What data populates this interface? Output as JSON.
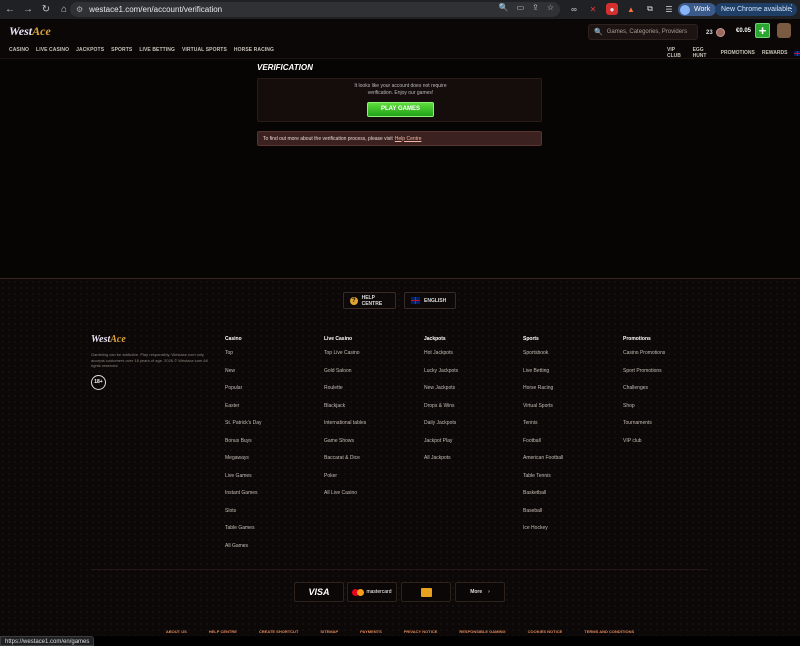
{
  "browser": {
    "url": "westace1.com/en/account/verification",
    "profile_label": "Work",
    "update_label": "New Chrome available",
    "status_url": "https://westace1.com/en/games"
  },
  "header": {
    "logo": {
      "a": "West",
      "b": "Ace"
    },
    "nav": [
      "CASINO",
      "LIVE CASINO",
      "JACKPOTS",
      "SPORTS",
      "LIVE BETTING",
      "VIRTUAL SPORTS",
      "HORSE RACING"
    ],
    "search_placeholder": "Games, Categories, Providers",
    "coins": "23",
    "balance": "€0.05",
    "right_nav": [
      "VIP CLUB",
      "EGG HUNT",
      "PROMOTIONS",
      "REWARDS"
    ]
  },
  "main": {
    "title": "VERIFICATION",
    "message_line1": "It looks like your account does not require",
    "message_line2": "verification. Enjoy our games!",
    "play_button": "PLAY GAMES",
    "info_text": "To find out more about the verification process, please visit",
    "info_link": "Help Centre"
  },
  "footer": {
    "help_centre": "HELP CENTRE",
    "language": "ENGLISH",
    "disclaimer": "Gambling can be addictive. Play responsibly. Westace.com only accepts customers over 18 years of age. 2026 © Westace.com All rights reserved.",
    "age_badge": "18+",
    "columns": [
      {
        "title": "Casino",
        "links": [
          "Top",
          "New",
          "Popular",
          "Easter",
          "St. Patrick's Day",
          "Bonus Buys",
          "Megaways",
          "Live Games",
          "Instant Games",
          "Slots",
          "Table Games",
          "All Games"
        ]
      },
      {
        "title": "Live Casino",
        "links": [
          "Top Live Casino",
          "Gold Saloon",
          "Roulette",
          "Blackjack",
          "International tables",
          "Game Shows",
          "Baccarat & Dice",
          "Poker",
          "All Live Casino"
        ]
      },
      {
        "title": "Jackpots",
        "links": [
          "Hot Jackpots",
          "Lucky Jackpots",
          "New Jackpots",
          "Drops & Wins",
          "Daily Jackpots",
          "Jackpot Play",
          "All Jackpots"
        ]
      },
      {
        "title": "Sports",
        "links": [
          "Sportsbook",
          "Live Betting",
          "Horse Racing",
          "Virtual Sports",
          "Tennis",
          "Football",
          "American Football",
          "Table Tennis",
          "Basketball",
          "Baseball",
          "Ice Hockey"
        ]
      },
      {
        "title": "Promotions",
        "links": [
          "Casino Promotions",
          "Sport Promotions",
          "Challenges",
          "Shop",
          "Tournaments",
          "VIP club"
        ]
      }
    ],
    "payments": {
      "visa": "VISA",
      "mastercard": "mastercard",
      "more": "More"
    },
    "bottom_links": [
      "ABOUT US",
      "HELP CENTRE",
      "CREATE SHORTCUT",
      "SITEMAP",
      "PAYMENTS",
      "PRIVACY NOTICE",
      "RESPONSIBLE GAMING",
      "COOKIES NOTICE",
      "TERMS AND CONDITIONS"
    ]
  }
}
